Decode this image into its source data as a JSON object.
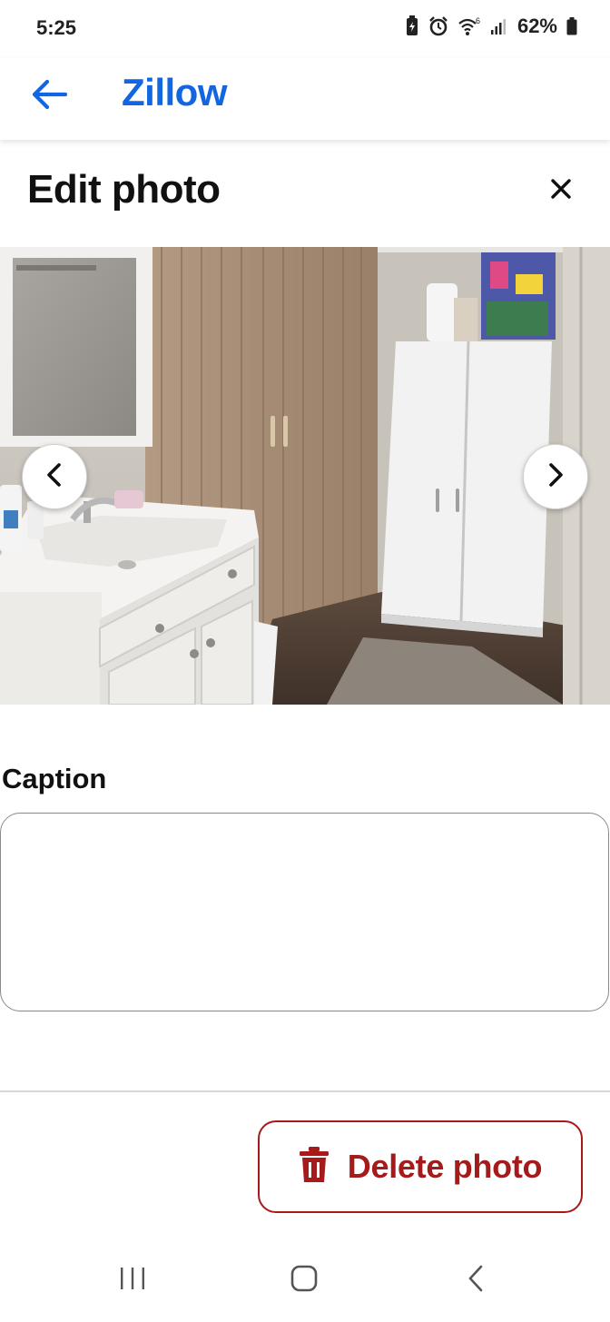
{
  "status_bar": {
    "time": "5:25",
    "battery_percent": "62%",
    "icons": [
      "battery-saver-icon",
      "alarm-icon",
      "wifi-icon",
      "signal-icon",
      "battery-icon"
    ]
  },
  "header": {
    "back_icon": "arrow-left-icon",
    "brand": "Zillow",
    "brand_color": "#1266e1"
  },
  "page": {
    "title": "Edit photo",
    "close_icon": "close-icon"
  },
  "photo": {
    "prev_icon": "chevron-left-icon",
    "next_icon": "chevron-right-icon"
  },
  "caption": {
    "label": "Caption",
    "value": "",
    "placeholder": ""
  },
  "actions": {
    "delete_label": "Delete photo",
    "delete_icon": "trash-icon",
    "danger_color": "#a51a1a"
  },
  "system_nav": {
    "recents_icon": "recents-icon",
    "home_icon": "home-icon",
    "back_icon": "back-icon"
  }
}
